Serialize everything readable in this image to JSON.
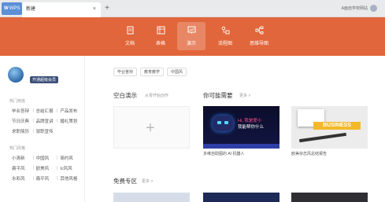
{
  "titlebar": {
    "app_tab_logo": "W",
    "app_tab_label": "WPS",
    "doc_tab_label": "新建",
    "doc_tab_close": "×",
    "add_tab": "+",
    "user_text": "A面自学校网站"
  },
  "ribbon": {
    "items": [
      {
        "label": "文档",
        "icon": "document-icon"
      },
      {
        "label": "表格",
        "icon": "table-icon"
      },
      {
        "label": "演示",
        "icon": "presentation-icon",
        "active": true
      },
      {
        "label": "流程图",
        "icon": "flowchart-icon"
      },
      {
        "label": "思维导图",
        "icon": "mindmap-icon"
      }
    ],
    "color": "#e2663b"
  },
  "sidebar": {
    "vip_label": "开通超级会员",
    "section_uses": "热门用途",
    "uses": [
      "毕业答辩",
      "总结汇报",
      "产品发布",
      "节日庆典",
      "品牌宣讲",
      "婚礼策划",
      "求职简历",
      "就职宣传"
    ],
    "section_styles": "热门风格",
    "styles": [
      "小清新",
      "中国风",
      "简约风",
      "扁平风",
      "欧美风",
      "Ic风风",
      "水彩风",
      "扁平风",
      "其他风格"
    ]
  },
  "main": {
    "tags": [
      "毕业答辩",
      "教育教学",
      "中国风"
    ],
    "blank_title": "空白演示",
    "blank_sub": "从零开始创作",
    "blank_plus": "+",
    "recommend_title": "你可能需要",
    "recommend_more": "更多 >",
    "ai_line1": "Hi, 我是爱小",
    "ai_line2": "我能帮你什么",
    "ai_caption": "多维自助图的 AI 机器人",
    "biz_label": "BUSINESS",
    "biz_caption": "欧美杂志风总结报告",
    "free_title": "免费专区",
    "free_more": "更多 >"
  }
}
